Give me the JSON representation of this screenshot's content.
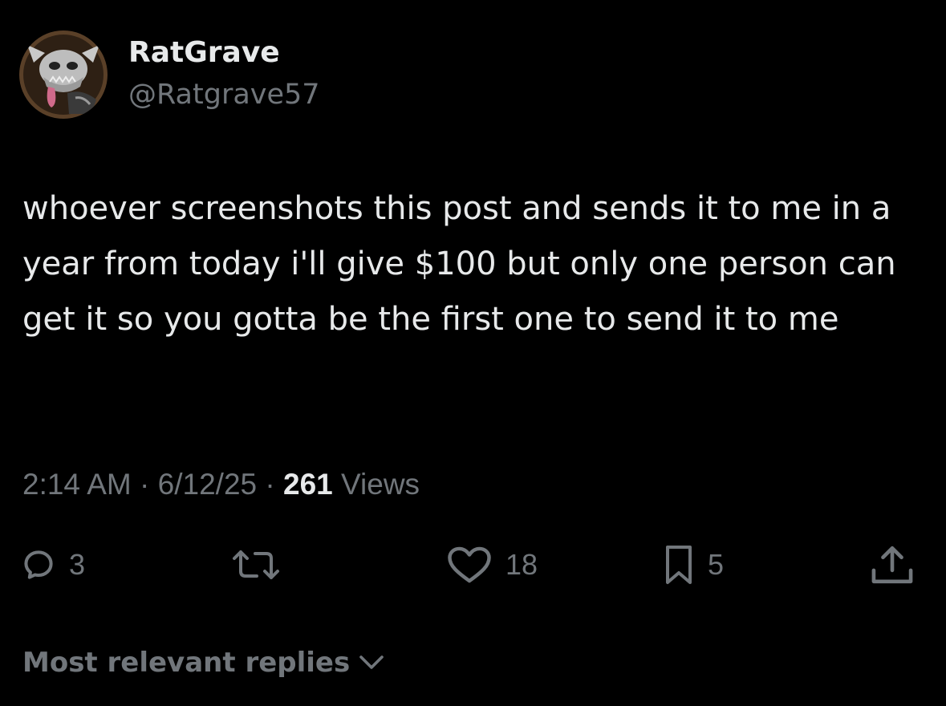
{
  "author": {
    "display_name": "RatGrave",
    "handle": "@Ratgrave57",
    "avatar_icon": "skull-creature-avatar"
  },
  "post": {
    "text": "whoever screenshots this post and sends it to me in a year from today i'll give $100 but only one person can get it so you gotta be the first one to send it to me"
  },
  "meta": {
    "time": "2:14 AM",
    "separator": " · ",
    "date": "6/12/25",
    "views_count": "261",
    "views_label": " Views"
  },
  "actions": {
    "reply": {
      "icon": "reply-icon",
      "count": "3"
    },
    "repost": {
      "icon": "repost-icon",
      "count": ""
    },
    "like": {
      "icon": "heart-icon",
      "count": "18"
    },
    "bookmark": {
      "icon": "bookmark-icon",
      "count": "5"
    },
    "share": {
      "icon": "share-icon"
    }
  },
  "replies": {
    "sort_label": "Most relevant replies",
    "icon": "chevron-down-icon"
  },
  "colors": {
    "background": "#000000",
    "primary_text": "#e7e9ea",
    "secondary_text": "#71767b"
  }
}
